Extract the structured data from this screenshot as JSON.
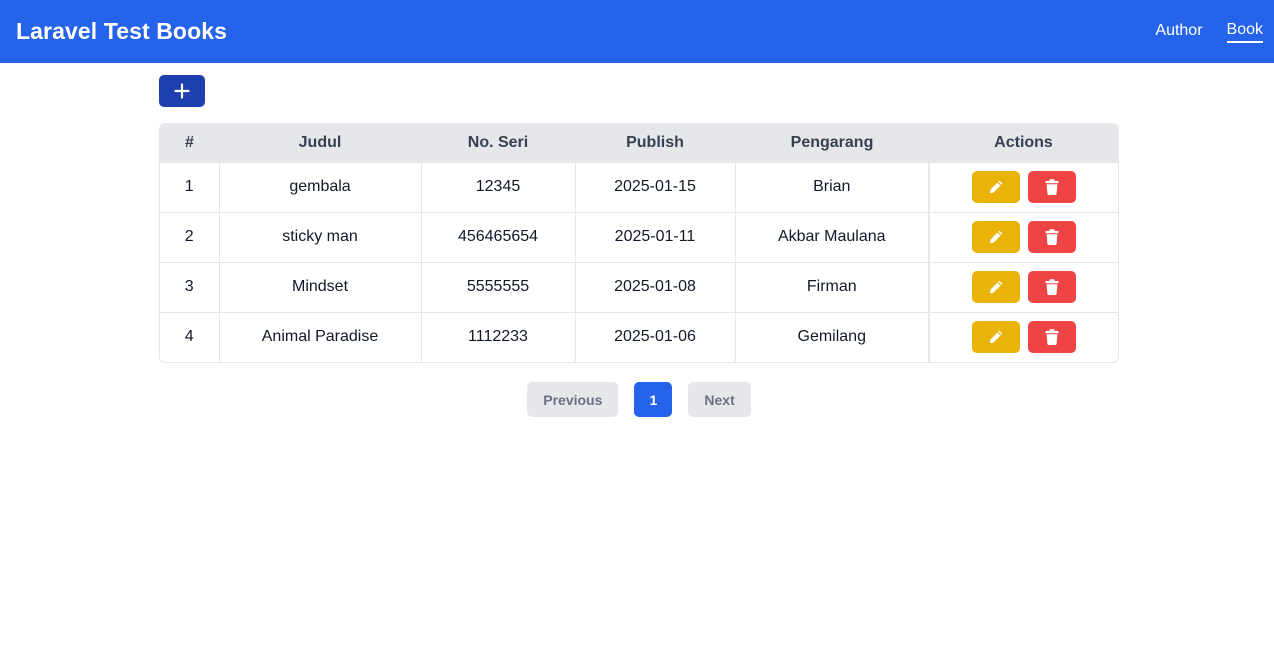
{
  "navbar": {
    "brand": "Laravel Test Books",
    "links": [
      {
        "label": "Author",
        "active": false
      },
      {
        "label": "Book",
        "active": true
      }
    ]
  },
  "toolbar": {
    "add_icon": "plus-icon"
  },
  "table": {
    "headers": [
      "#",
      "Judul",
      "No. Seri",
      "Publish",
      "Pengarang",
      "Actions"
    ],
    "rows": [
      {
        "num": "1",
        "judul": "gembala",
        "seri": "12345",
        "publish": "2025-01-15",
        "pengarang": "Brian"
      },
      {
        "num": "2",
        "judul": "sticky man",
        "seri": "456465654",
        "publish": "2025-01-11",
        "pengarang": "Akbar Maulana"
      },
      {
        "num": "3",
        "judul": "Mindset",
        "seri": "5555555",
        "publish": "2025-01-08",
        "pengarang": "Firman"
      },
      {
        "num": "4",
        "judul": "Animal Paradise",
        "seri": "1112233",
        "publish": "2025-01-06",
        "pengarang": "Gemilang"
      }
    ],
    "edit_icon": "pencil-icon",
    "delete_icon": "trash-icon"
  },
  "pagination": {
    "previous_label": "Previous",
    "current_page": "1",
    "next_label": "Next"
  },
  "colors": {
    "primary": "#2563eb",
    "add_button": "#1e40af",
    "edit": "#eab308",
    "delete": "#ef4444"
  }
}
